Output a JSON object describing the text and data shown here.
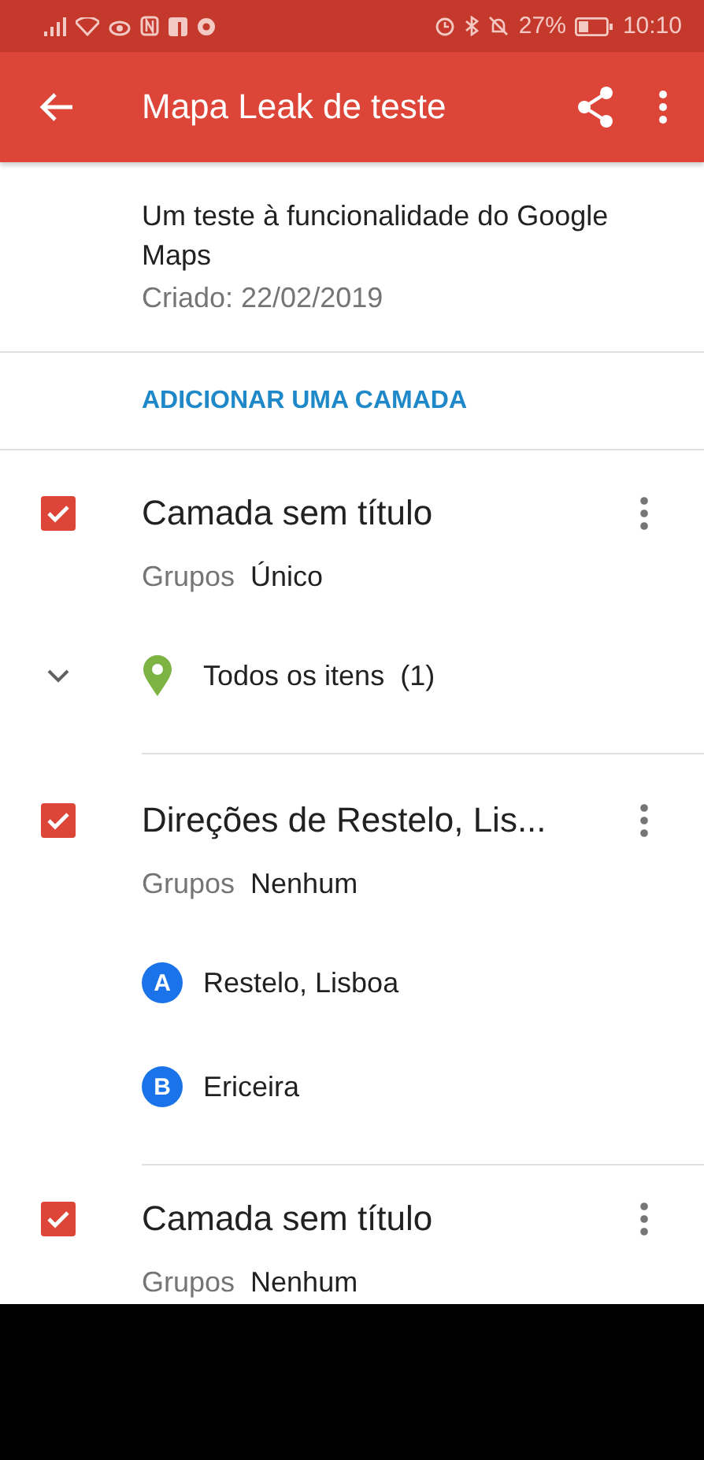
{
  "status_bar": {
    "battery": "27%",
    "time": "10:10"
  },
  "app_bar": {
    "title": "Mapa Leak de teste"
  },
  "map": {
    "description": "Um teste à funcionalidade do Google Maps",
    "created": "Criado: 22/02/2019"
  },
  "add_layer": "ADICIONAR UMA CAMADA",
  "layers": [
    {
      "title": "Camada sem título",
      "checked": true,
      "groups_label": "Grupos",
      "groups_value": "Único",
      "items": [
        {
          "kind": "group",
          "label": "Todos os itens",
          "count": "(1)"
        }
      ]
    },
    {
      "title": "Direções de Restelo, Lis...",
      "checked": true,
      "groups_label": "Grupos",
      "groups_value": "Nenhum",
      "items": [
        {
          "kind": "place",
          "marker": "A",
          "label": "Restelo, Lisboa"
        },
        {
          "kind": "place",
          "marker": "B",
          "label": "Ericeira"
        }
      ]
    },
    {
      "title": "Camada sem título",
      "checked": true,
      "groups_label": "Grupos",
      "groups_value": "Nenhum"
    }
  ]
}
